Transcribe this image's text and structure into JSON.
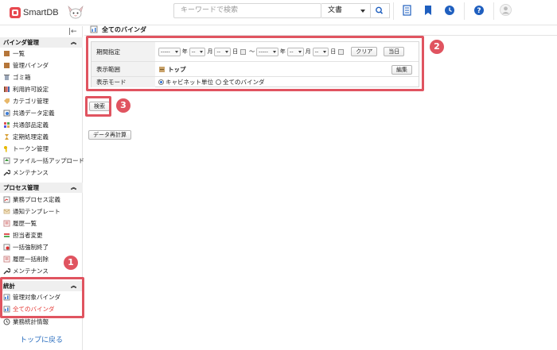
{
  "header": {
    "logo_text": "SmartDB",
    "search_placeholder": "キーワードで検索",
    "search_scope": "文書"
  },
  "sidebar": {
    "collapse_icon": "|←",
    "sections": [
      {
        "title": "バインダ管理",
        "items": [
          "一覧",
          "管理バインダ",
          "ゴミ箱",
          "利用許可設定",
          "カテゴリ管理",
          "共通データ定義",
          "共通部品定義",
          "定期処理定義",
          "トークン管理",
          "ファイル一括アップロード",
          "メンテナンス"
        ]
      },
      {
        "title": "プロセス管理",
        "items": [
          "業務プロセス定義",
          "通知テンプレート",
          "履歴一覧",
          "担当者変更",
          "一括強制終了",
          "履歴一括削除",
          "メンテナンス"
        ]
      },
      {
        "title": "統計",
        "items": [
          "管理対象バインダ",
          "全てのバインダ",
          "業務統計情報"
        ]
      }
    ],
    "active_item": "全てのバインダ",
    "back_link": "トップに戻る"
  },
  "main": {
    "title": "全てのバインダ",
    "form": {
      "period_label": "期間指定",
      "date_placeholder_year": "-----",
      "date_placeholder": "--",
      "year_unit": "年",
      "month_unit": "月",
      "day_unit": "日",
      "range_sep": "〜",
      "clear_button": "クリア",
      "today_button": "当日",
      "range_label": "表示範囲",
      "range_value": "トップ",
      "edit_button": "編集",
      "mode_label": "表示モード",
      "mode_option1": "キャビネット単位",
      "mode_option2": "全てのバインダ"
    },
    "search_button": "検索",
    "recalc_button": "データ再計算"
  },
  "callouts": [
    "1",
    "2",
    "3"
  ],
  "colors": {
    "accent": "#e05460",
    "link": "#2a6ebf",
    "active": "#e53935",
    "icon_blue": "#1f5fbf"
  }
}
